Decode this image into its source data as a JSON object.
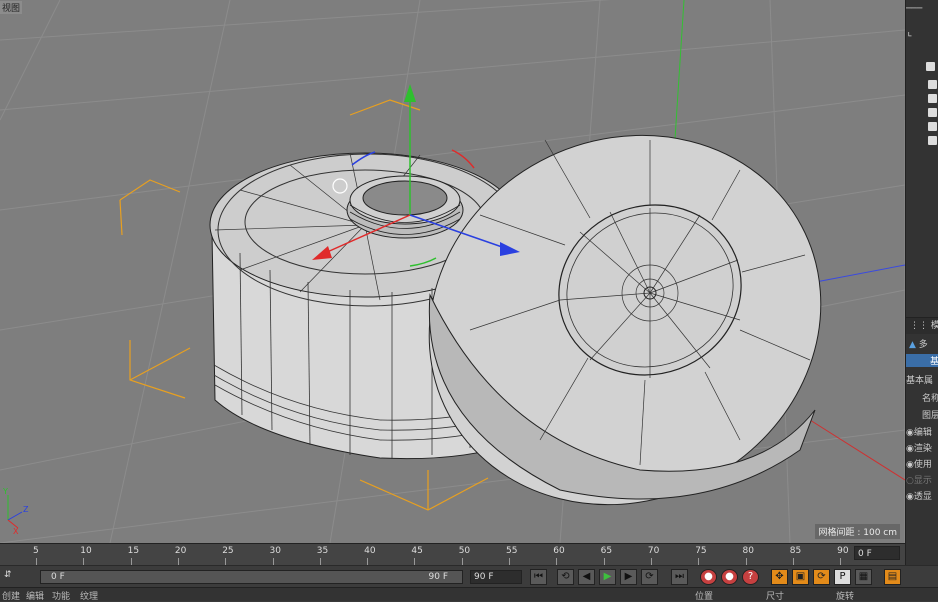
{
  "viewport": {
    "title": "视图",
    "grid_distance": "网格间距 : 100 cm"
  },
  "timeline": {
    "ticks": [
      "5",
      "10",
      "15",
      "20",
      "25",
      "30",
      "35",
      "40",
      "45",
      "50",
      "55",
      "60",
      "65",
      "70",
      "75",
      "80",
      "85",
      "90"
    ],
    "current_frame": "0 F"
  },
  "transport": {
    "range_start": "0 F",
    "range_end": "90 F",
    "end_field": "90 F"
  },
  "right_panel": {
    "tab_label": "模",
    "object_label": "多",
    "basic_label": "基本属",
    "name_label": "名称",
    "layer_label": "图层",
    "edit_label": "编辑",
    "render_label": "渲染",
    "use_label": "使用",
    "display_label": "显示",
    "transparency_label": "透显"
  },
  "bottom_strip": {
    "create": "创建",
    "edit": "编辑",
    "function": "功能",
    "texture": "纹理",
    "position": "位置",
    "size": "尺寸",
    "rotation": "旋转"
  },
  "colors": {
    "x_axis": "#e02a2a",
    "y_axis": "#2ec02e",
    "z_axis": "#2a40e0",
    "bbox": "#e8a020",
    "accent": "#e38b1a"
  }
}
